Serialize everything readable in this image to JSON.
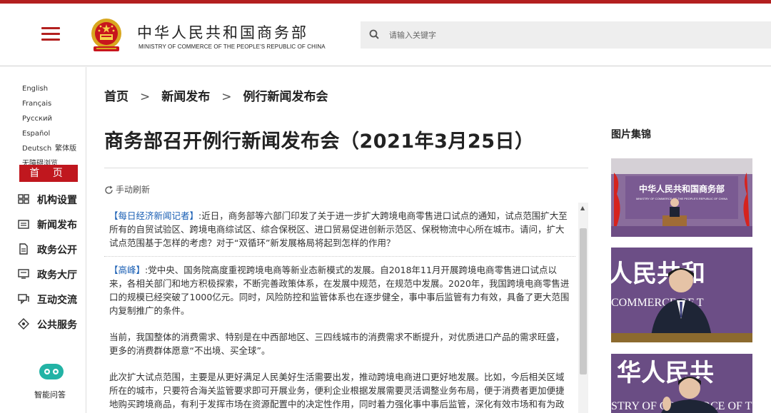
{
  "header": {
    "title_cn": "中华人民共和国商务部",
    "title_en": "MINISTRY OF COMMERCE OF THE PEOPLE'S REPUBLIC OF CHINA",
    "search_placeholder": "请输入关键字",
    "accent_color": "#b3201f"
  },
  "sidebar": {
    "languages": [
      "English",
      "Français",
      "Русский",
      "Español",
      "Deutsch",
      "繁体版",
      "无障碍浏览"
    ],
    "home_label": "首 页",
    "nav": [
      {
        "label": "机构设置",
        "icon": "org-chart-icon"
      },
      {
        "label": "新闻发布",
        "icon": "news-icon"
      },
      {
        "label": "政务公开",
        "icon": "document-icon"
      },
      {
        "label": "政务大厅",
        "icon": "service-hall-icon"
      },
      {
        "label": "互动交流",
        "icon": "chat-icon"
      },
      {
        "label": "公共服务",
        "icon": "public-service-icon"
      }
    ],
    "assistant_label": "智能问答"
  },
  "breadcrumb": [
    "首页",
    "新闻发布",
    "例行新闻发布会"
  ],
  "article": {
    "title": "商务部召开例行新闻发布会（2021年3月25日）",
    "refresh_label": "手动刷新",
    "q1_speaker": "【每日经济新闻记者】",
    "q1_text": ":近日，商务部等六部门印发了关于进一步扩大跨境电商零售进口试点的通知，试点范围扩大至所有的自贸试验区、跨境电商综试区、综合保税区、进口贸易促进创新示范区、保税物流中心所在城市。请问，扩大试点范围基于怎样的考虑？对于“双循环”新发展格局将起到怎样的作用？",
    "a1_speaker": "【高峰】",
    "a1_text": ":党中央、国务院高度重视跨境电商等新业态新模式的发展。自2018年11月开展跨境电商零售进口试点以来，各相关部门和地方积极探索，不断完善政策体系，在发展中规范，在规范中发展。2020年，我国跨境电商零售进口的规模已经突破了1000亿元。同时，风险防控和监管体系也在逐步健全，事中事后监管有力有效，具备了更大范围内复制推广的条件。",
    "p2": "当前，我国整体的消费需求、特别是在中西部地区、三四线城市的消费需求不断提升，对优质进口产品的需求旺盛，更多的消费群体愿意“不出境、买全球”。",
    "p3": "此次扩大试点范围，主要是从更好满足人民美好生活需要出发，推动跨境电商进口更好地发展。比如，今后相关区域所在的城市，只要符合海关监管要求即可开展业务，便利企业根据发展需要灵活调整业务布局，便于消费者更加便捷地购买跨境商品，有利于发挥市场在资源配置中的决定性作用，同时着力强化事中事后监管，深化有效市场和有为政府的结合。"
  },
  "gallery": {
    "title": "图片集锦",
    "photo1_banner": "中华人民共和国商务部",
    "photo1_banner_en": "MINISTRY OF COMMERCE OF THE PEOPLE'S REPUBLIC OF CHINA",
    "photo2_banner": "人民共和",
    "photo2_banner_en": "COMMERCE OF T",
    "photo3_banner": "华人民共",
    "photo3_banner_en": "STRY OF COMMERCE OF THE"
  }
}
